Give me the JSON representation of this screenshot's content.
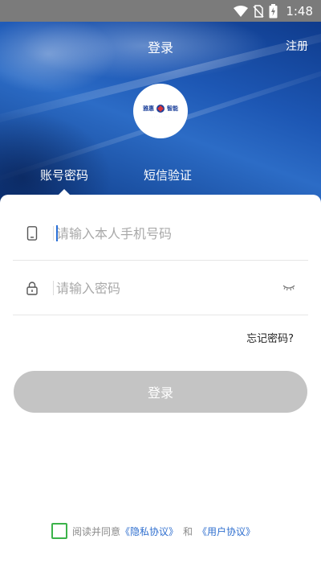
{
  "status_bar": {
    "time": "1:48",
    "icons": [
      "wifi-icon",
      "no-sim-icon",
      "battery-charging-icon"
    ]
  },
  "header": {
    "title": "登录",
    "register_label": "注册"
  },
  "logo": {
    "left_text": "雅惠",
    "right_text": "智能"
  },
  "tabs": [
    {
      "label": "账号密码",
      "active": true
    },
    {
      "label": "短信验证",
      "active": false
    }
  ],
  "form": {
    "phone": {
      "placeholder": "请输入本人手机号码",
      "value": "",
      "icon": "phone-icon"
    },
    "password": {
      "placeholder": "请输入密码",
      "value": "",
      "icon": "lock-icon",
      "toggle_icon": "eye-closed-icon"
    },
    "forgot_label": "忘记密码?",
    "login_label": "登录"
  },
  "agreement": {
    "checked": false,
    "prefix": "阅读并同意",
    "privacy_label": "《隐私协议》",
    "and_label": "和",
    "user_label": "《用户协议》"
  },
  "colors": {
    "accent": "#2f6fcf",
    "button_disabled": "#c4c4c4",
    "checkbox_border": "#3bb34a",
    "status_bar": "#7b7b7b"
  }
}
